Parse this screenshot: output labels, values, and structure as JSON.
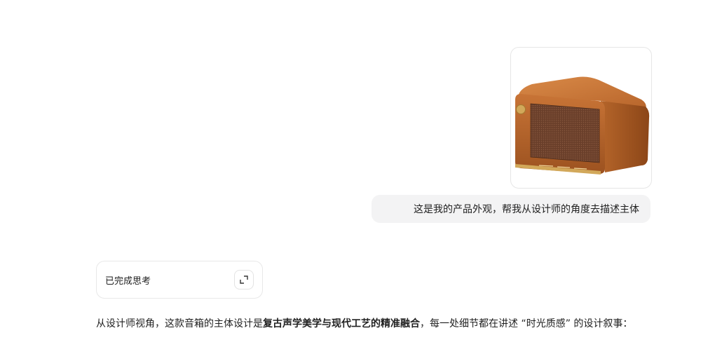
{
  "user_message": {
    "image_subject": "wooden-speaker-product-photo",
    "text": "这是我的产品外观，帮我从设计师的角度去描述主体"
  },
  "thinking": {
    "label": "已完成思考",
    "expand_icon": "expand-icon"
  },
  "answer": {
    "part1": "从设计师视角，这款音箱的主体设计是",
    "highlight": "复古声学美学与现代工艺的精准融合",
    "part2": "，每一处细节都在讲述 “时光质感” 的设计叙事："
  },
  "colors": {
    "wood": "#b5652a",
    "grille": "#6a3f2a",
    "brass": "#d2a85a",
    "bubble_bg": "#f3f3f4"
  }
}
